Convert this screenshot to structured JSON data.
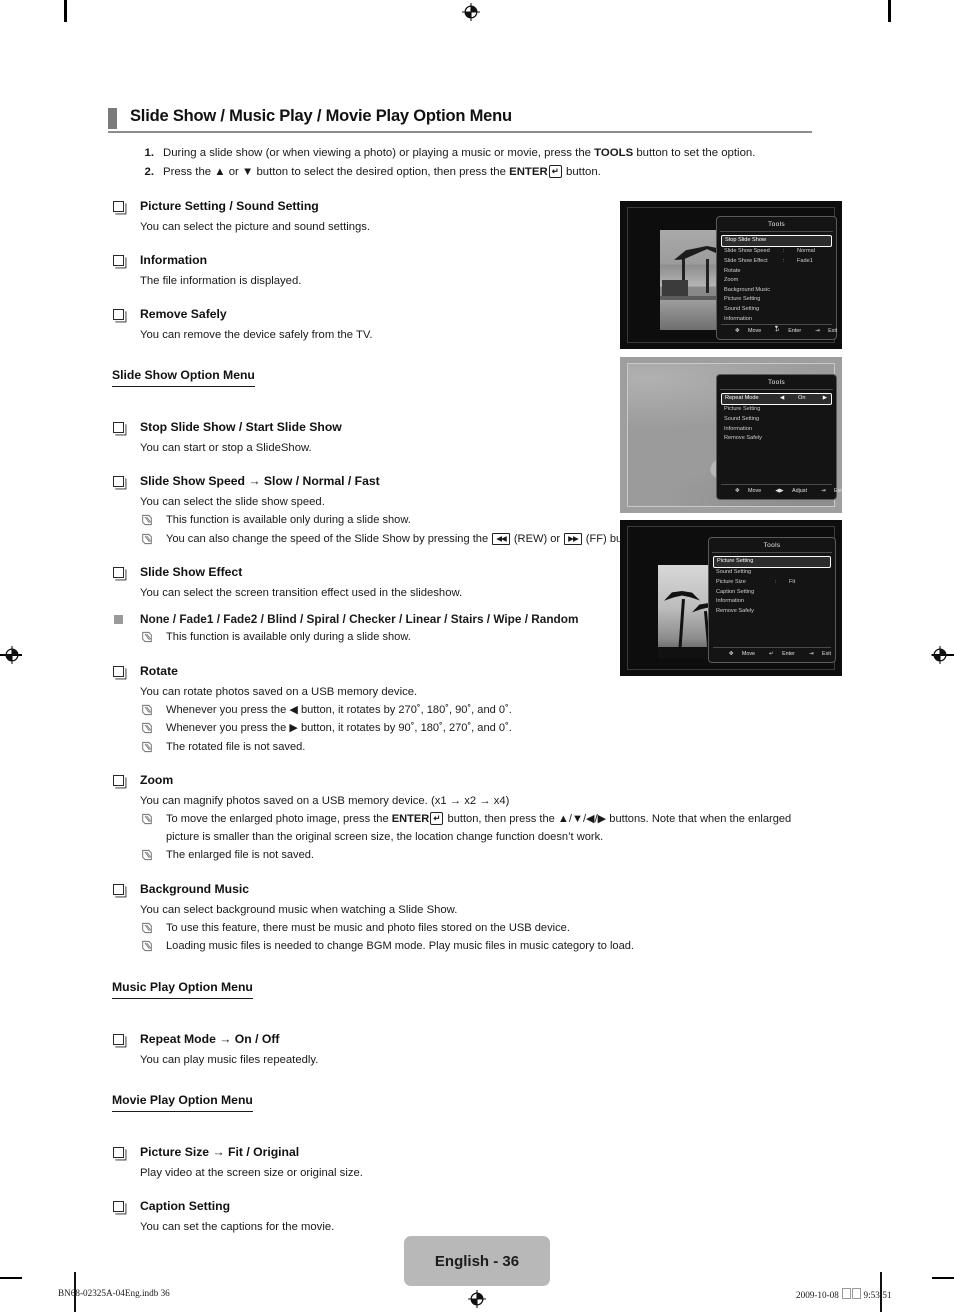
{
  "document": {
    "title": "Slide Show / Music Play / Movie Play Option Menu",
    "page_label": "English - 36",
    "footer_left": "BN68-02325A-04Eng.indb   36",
    "footer_right_date": "2009-10-08",
    "footer_right_time": "9:53:51"
  },
  "steps": [
    {
      "num": "1.",
      "html": "During a slide show (or when viewing a photo) or playing a music or movie, press the <b>TOOLS</b> button to set the option."
    },
    {
      "num": "2.",
      "html": "Press the &#9650; or &#9660; button to select the desired option, then press the <b>ENTER</b><span class=\"enterkey\">&#8629;</span> button."
    }
  ],
  "sections": [
    {
      "type": "item",
      "heading": "Picture Setting / Sound Setting",
      "body": "You can select the picture and sound settings."
    },
    {
      "type": "item",
      "heading": "Information",
      "body": "The file information is displayed."
    },
    {
      "type": "item",
      "heading": "Remove Safely",
      "body": "You can remove the device safely from the TV."
    },
    {
      "type": "section-title",
      "heading": "Slide Show Option Menu"
    },
    {
      "type": "item",
      "heading": "Stop Slide Show / Start Slide Show",
      "body": "You can start or stop a SlideShow."
    },
    {
      "type": "item",
      "heading": "Slide Show Speed → Slow / Normal / Fast",
      "body": "You can select the slide show speed.",
      "notes": [
        "This function is available only during a slide show.",
        "You can also change the speed of the Slide Show by pressing the <span class=\"ffkey\">&#9664;&#9664;</span> (REW) or <span class=\"ffkey\">&#9654;&#9654;</span> (FF) button during the Slide Show."
      ]
    },
    {
      "type": "item",
      "heading": "Slide Show Effect",
      "body": "You can select the screen transition effect used in the slideshow.",
      "square_line": "None / Fade1 / Fade2 / Blind / Spiral / Checker / Linear / Stairs / Wipe / Random",
      "square_notes": [
        "This function is available only during a slide show."
      ]
    },
    {
      "type": "item",
      "heading": "Rotate",
      "body": "You can rotate photos saved on a USB memory device.",
      "notes": [
        "Whenever you press the &#9664; button, it rotates by 270&#730;, 180&#730;, 90&#730;, and 0&#730;.",
        "Whenever you press the &#9654; button, it rotates by 90&#730;, 180&#730;, 270&#730;, and 0&#730;.",
        "The rotated file is not saved."
      ]
    },
    {
      "type": "item",
      "heading": "Zoom",
      "body": "You can magnify photos saved on a USB memory device. (x1 → x2 → x4)",
      "notes": [
        "To move the enlarged photo image, press the <b>ENTER</b><span class=\"enterkey\">&#8629;</span> button, then press the &#9650;/&#9660;/&#9664;/&#9654; buttons. Note that when the enlarged picture is smaller than the original screen size, the location change function doesn&#8217;t work.",
        "The enlarged file is not saved."
      ]
    },
    {
      "type": "item",
      "heading": "Background Music",
      "body": "You can select background music when watching a Slide Show.",
      "notes": [
        "To use this feature, there must be music and photo files stored on the USB device.",
        "Loading music files is needed to change BGM mode. Play music files in music category to load."
      ]
    },
    {
      "type": "section-title",
      "heading": "Music Play Option Menu"
    },
    {
      "type": "item",
      "heading": "Repeat Mode → On / Off",
      "body": "You can play music files repeatedly."
    },
    {
      "type": "section-title",
      "heading": "Movie Play Option Menu"
    },
    {
      "type": "item",
      "heading": "Picture Size → Fit / Original",
      "body": "Play video at the screen size or original size."
    },
    {
      "type": "item",
      "heading": "Caption Setting",
      "body": "You can set the captions for the movie."
    }
  ],
  "tv_screens": [
    {
      "id": "slide-show-tools",
      "dialog_title": "Tools",
      "rows": [
        {
          "label": "Stop Slide Show",
          "selected": true
        },
        {
          "label": "Slide Show Speed",
          "sep": ":",
          "value": "Normal"
        },
        {
          "label": "Slide Show Effect",
          "sep": ":",
          "value": "Fade1"
        },
        {
          "label": "Rotate"
        },
        {
          "label": "Zoom"
        },
        {
          "label": "Background Music"
        },
        {
          "label": "Picture Setting"
        },
        {
          "label": "Sound Setting"
        },
        {
          "label": "Information"
        }
      ],
      "more_indicator": "▼",
      "footer": [
        {
          "icon": "✥",
          "label": "Move"
        },
        {
          "icon": "↵",
          "label": "Enter"
        },
        {
          "icon": "⇥",
          "label": "Exit"
        }
      ]
    },
    {
      "id": "music-play-tools",
      "dialog_title": "Tools",
      "rows": [
        {
          "label": "Repeat Mode",
          "left_arrow": "◀",
          "value": "On",
          "right_arrow": "▶",
          "selected": true
        },
        {
          "label": "Picture Setting"
        },
        {
          "label": "Sound Setting"
        },
        {
          "label": "Information"
        },
        {
          "label": "Remove Safely"
        }
      ],
      "footer": [
        {
          "icon": "✥",
          "label": "Move"
        },
        {
          "icon": "◀▶",
          "label": "Adjust"
        },
        {
          "icon": "⇥",
          "label": "Exit"
        }
      ]
    },
    {
      "id": "movie-play-tools",
      "dialog_title": "Tools",
      "rows": [
        {
          "label": "Picture Setting",
          "selected": true
        },
        {
          "label": "Sound Setting"
        },
        {
          "label": "Picture Size",
          "sep": ":",
          "value": "Fit"
        },
        {
          "label": "Caption Setting"
        },
        {
          "label": "Information"
        },
        {
          "label": "Remove Safely"
        }
      ],
      "footer": [
        {
          "icon": "✥",
          "label": "Move"
        },
        {
          "icon": "↵",
          "label": "Enter"
        },
        {
          "icon": "⇥",
          "label": "Exit"
        }
      ]
    }
  ]
}
